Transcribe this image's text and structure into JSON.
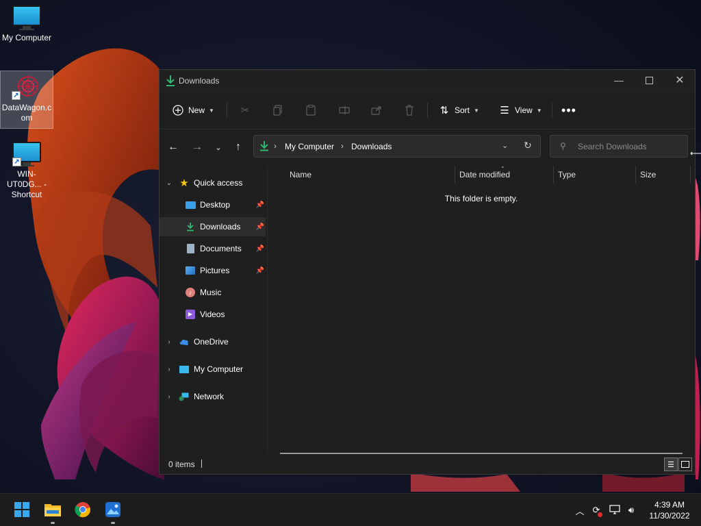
{
  "desktop": {
    "icons": [
      {
        "label": "My Computer",
        "icon": "my-computer-icon"
      },
      {
        "label": "DataWagon.com",
        "icon": "datawagon-shortcut-icon",
        "selected": true
      },
      {
        "label": "WIN-UT0DG... - Shortcut",
        "icon": "remote-shortcut-icon"
      }
    ]
  },
  "window": {
    "title": "Downloads",
    "controls": [
      "minimize",
      "maximize",
      "close"
    ],
    "command_bar": {
      "new_label": "New",
      "cut": "cut-icon",
      "copy": "copy-icon",
      "paste": "paste-icon",
      "rename": "rename-icon",
      "share": "share-icon",
      "delete": "delete-icon",
      "sort_label": "Sort",
      "view_label": "View",
      "more": "more-options-icon"
    },
    "address": {
      "crumbs": [
        "My Computer",
        "Downloads"
      ]
    },
    "search": {
      "placeholder": "Search Downloads"
    },
    "sidebar": {
      "quick_access": "Quick access",
      "items": [
        {
          "label": "Desktop",
          "pinned": true
        },
        {
          "label": "Downloads",
          "pinned": true,
          "selected": true
        },
        {
          "label": "Documents",
          "pinned": true
        },
        {
          "label": "Pictures",
          "pinned": true
        },
        {
          "label": "Music",
          "pinned": false
        },
        {
          "label": "Videos",
          "pinned": false
        }
      ],
      "roots": [
        {
          "label": "OneDrive"
        },
        {
          "label": "My Computer"
        },
        {
          "label": "Network"
        }
      ]
    },
    "columns": [
      "Name",
      "Date modified",
      "Type",
      "Size"
    ],
    "empty_message": "This folder is empty.",
    "status": {
      "item_count": "0 items"
    }
  },
  "taskbar": {
    "apps": [
      "start-icon",
      "file-explorer-icon",
      "chrome-icon",
      "photos-icon"
    ],
    "clock": {
      "time": "4:39 AM",
      "date": "11/30/2022"
    }
  },
  "colors": {
    "accent_green": "#2eb872",
    "window_bg": "#1f1f1f",
    "taskbar_bg": "#1c1c1c"
  }
}
